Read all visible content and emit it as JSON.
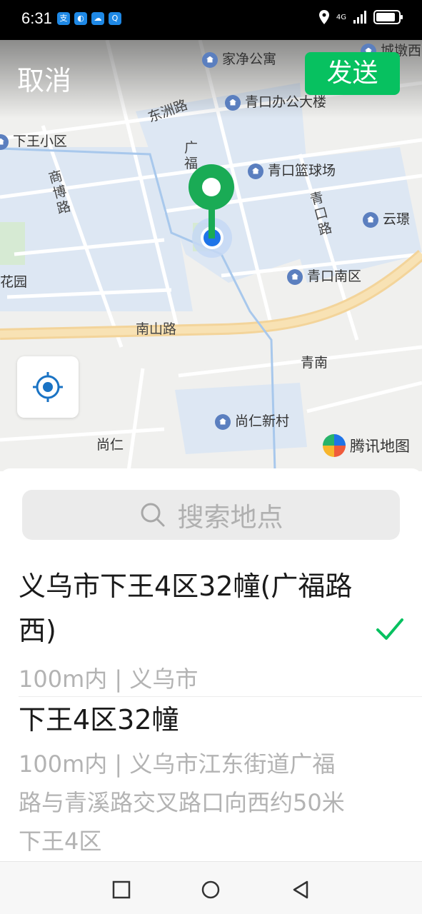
{
  "status_bar": {
    "time": "6:31",
    "network": "4G",
    "apps": [
      "支",
      "◐",
      "☁",
      "Q"
    ]
  },
  "header": {
    "cancel_label": "取消",
    "send_label": "发送",
    "send_color": "#07c160"
  },
  "map": {
    "attribution": "腾讯地图",
    "roads": [
      "东洲路",
      "广福",
      "商博路",
      "青口路",
      "南山路"
    ],
    "places": [
      "家净公寓",
      "城墩西",
      "青口办公大楼",
      "下王小区",
      "青口篮球场",
      "云璟",
      "花园",
      "青口南区",
      "青南",
      "尚仁新村",
      "尚仁"
    ],
    "pin_color": "#1aab55",
    "dot_color": "#1e74e8"
  },
  "search": {
    "placeholder": "搜索地点"
  },
  "results": [
    {
      "title": "义乌市下王4区32幢(广福路西)",
      "subtitle": "100m内 | 义乌市",
      "selected": true
    },
    {
      "title": "下王4区32幢",
      "subtitle": "100m内 | 义乌市江东街道广福路与青溪路交叉路口向西约50米下王4区",
      "selected": false
    }
  ],
  "nav": {
    "icons": [
      "recents-icon",
      "home-icon",
      "back-icon"
    ]
  }
}
